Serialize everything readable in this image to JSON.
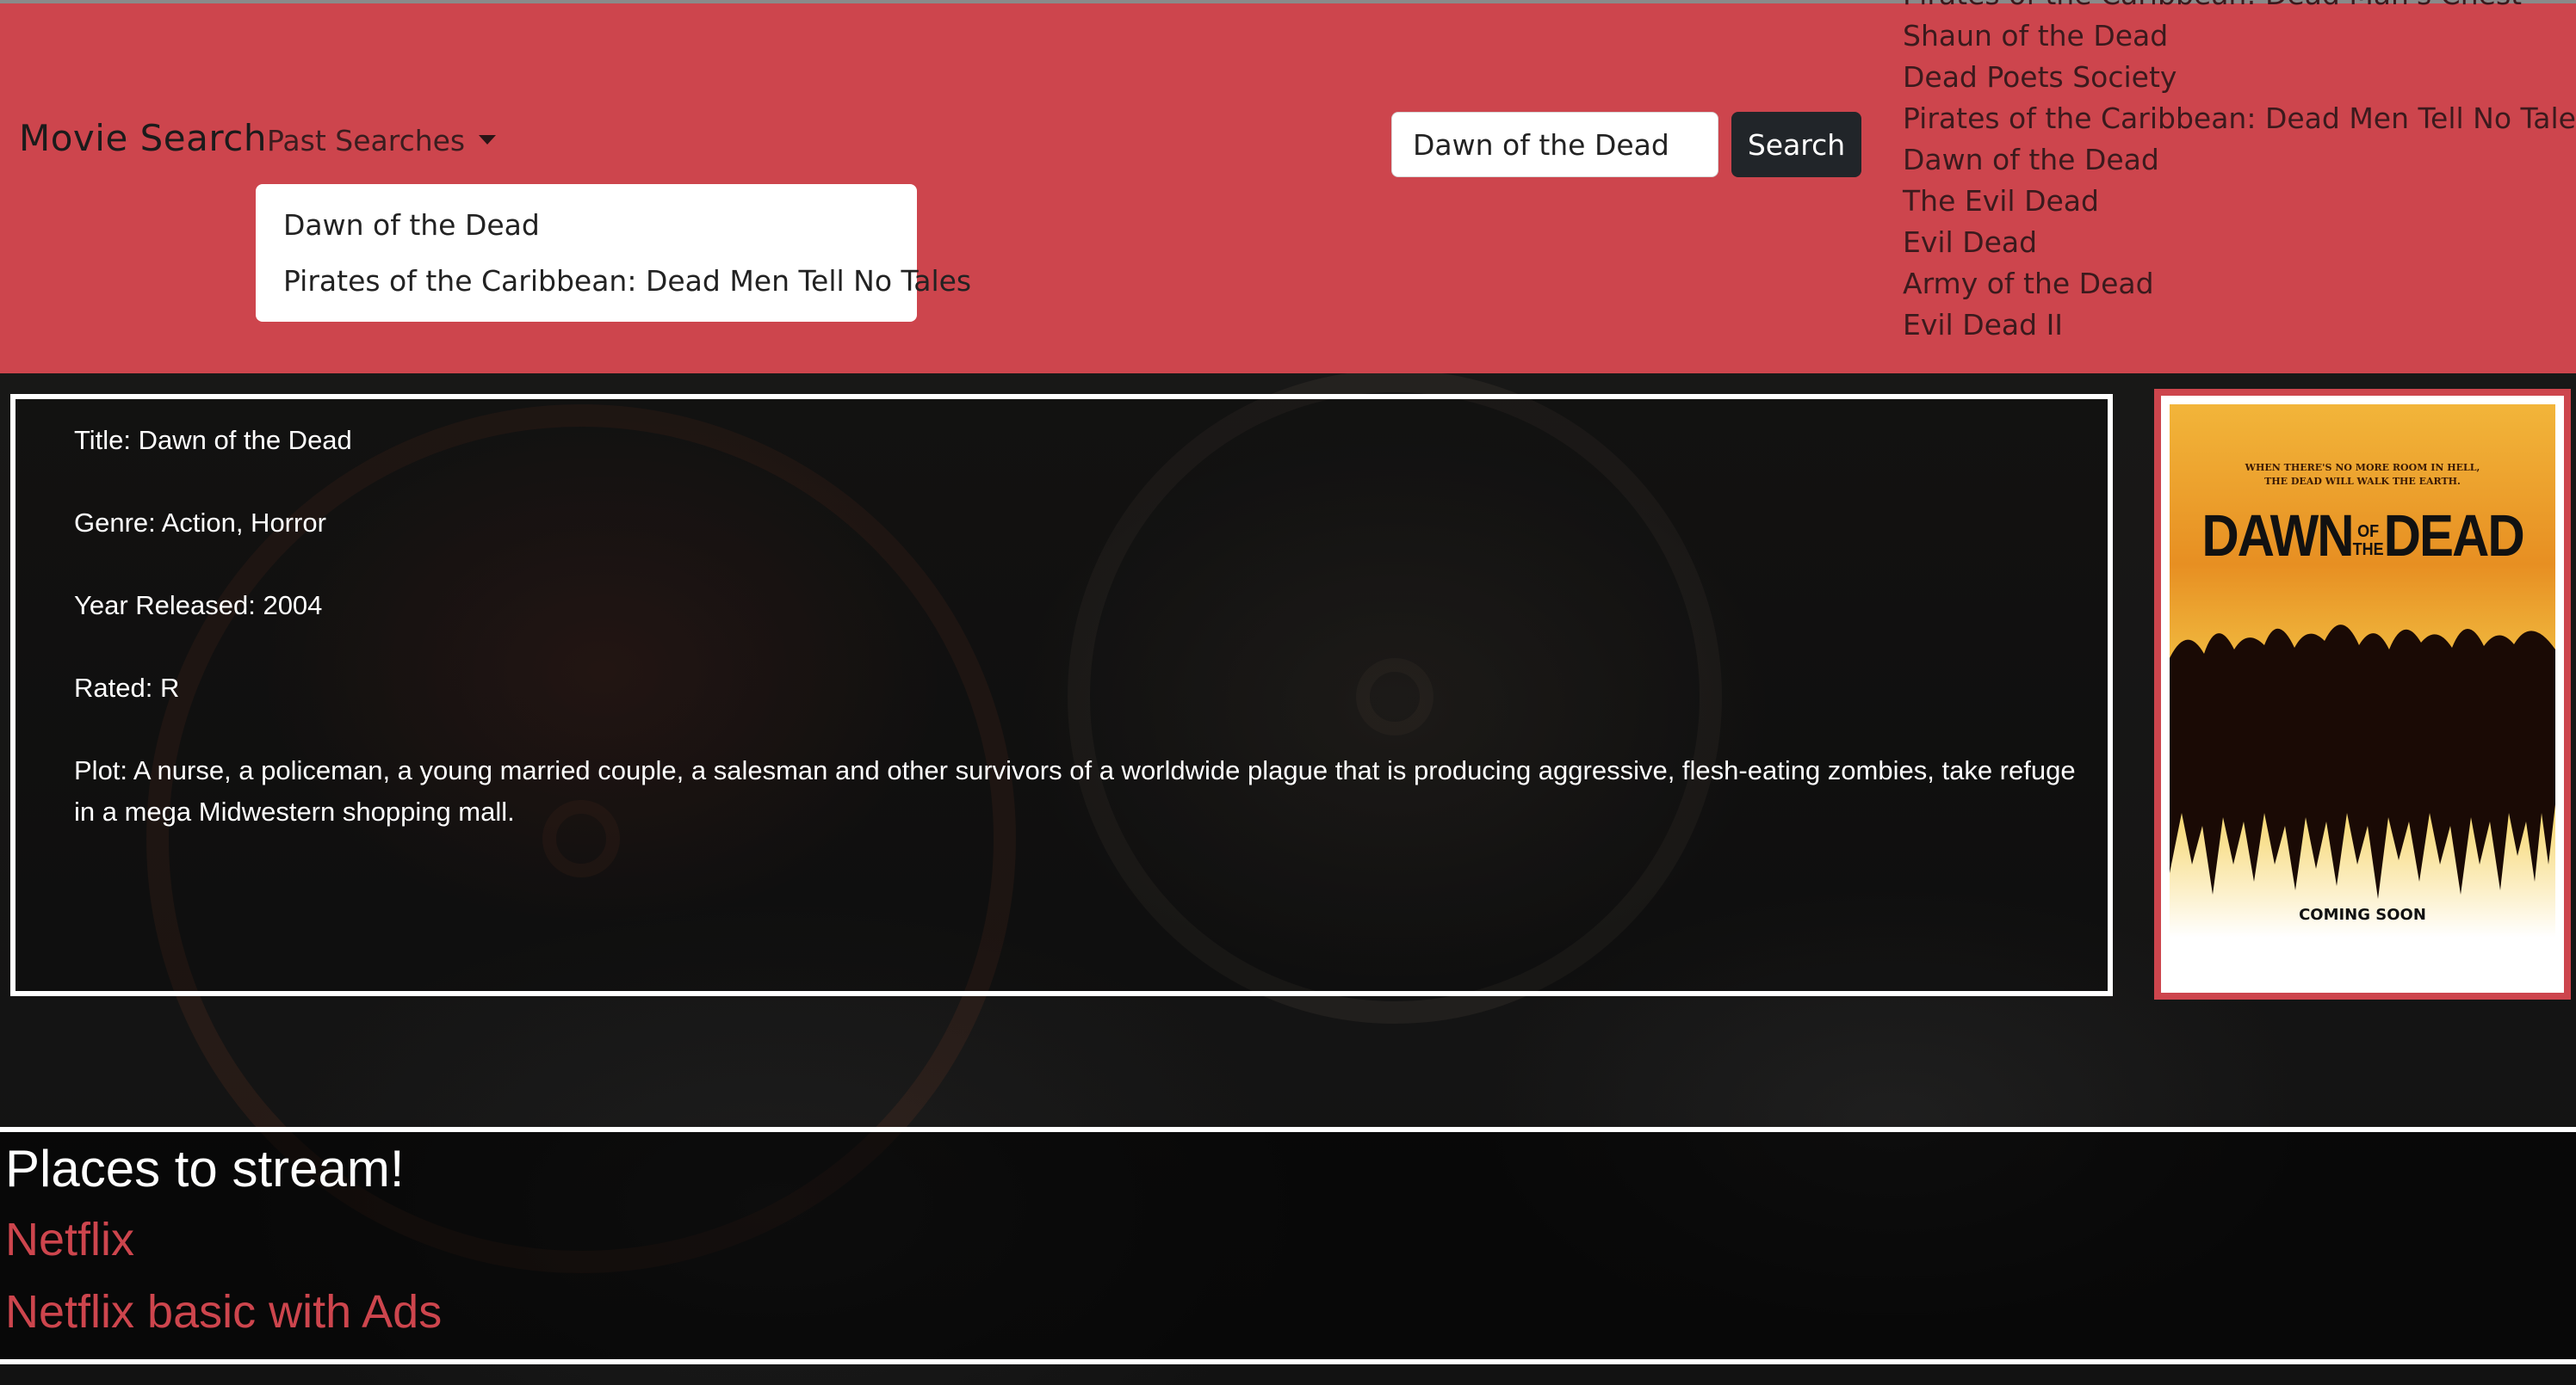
{
  "navbar": {
    "brand": "Movie Search",
    "past_searches_label": "Past Searches",
    "past_searches": [
      "Dawn of the Dead",
      "Pirates of the Caribbean: Dead Men Tell No Tales"
    ],
    "search": {
      "value": "Dawn of the Dead",
      "button_label": "Search"
    },
    "results": [
      "Pirates of the Caribbean: Dead Man's Chest",
      "Shaun of the Dead",
      "Dead Poets Society",
      "Pirates of the Caribbean: Dead Men Tell No Tales",
      "Dawn of the Dead",
      "The Evil Dead",
      "Evil Dead",
      "Army of the Dead",
      "Evil Dead II"
    ]
  },
  "details": {
    "title": "Title: Dawn of the Dead",
    "genre": "Genre: Action, Horror",
    "year": "Year Released: 2004",
    "rated": "Rated: R",
    "plot": "Plot: A nurse, a policeman, a young married couple, a salesman and other survivors of a worldwide plague that is producing aggressive, flesh-eating zombies, take refuge in a mega Midwestern shopping mall."
  },
  "poster": {
    "tagline_1": "WHEN THERE'S NO MORE ROOM IN HELL,",
    "tagline_2": "THE DEAD WILL WALK THE EARTH.",
    "title_a": "DAWN",
    "title_of": "OF",
    "title_the": "THE",
    "title_b": "DEAD",
    "footer": "COMING SOON"
  },
  "streaming": {
    "heading": "Places to stream!",
    "services": [
      "Netflix",
      "Netflix basic with Ads"
    ]
  },
  "colors": {
    "accent": "#cd454d",
    "button_dark": "#212529",
    "background": "#141414"
  }
}
